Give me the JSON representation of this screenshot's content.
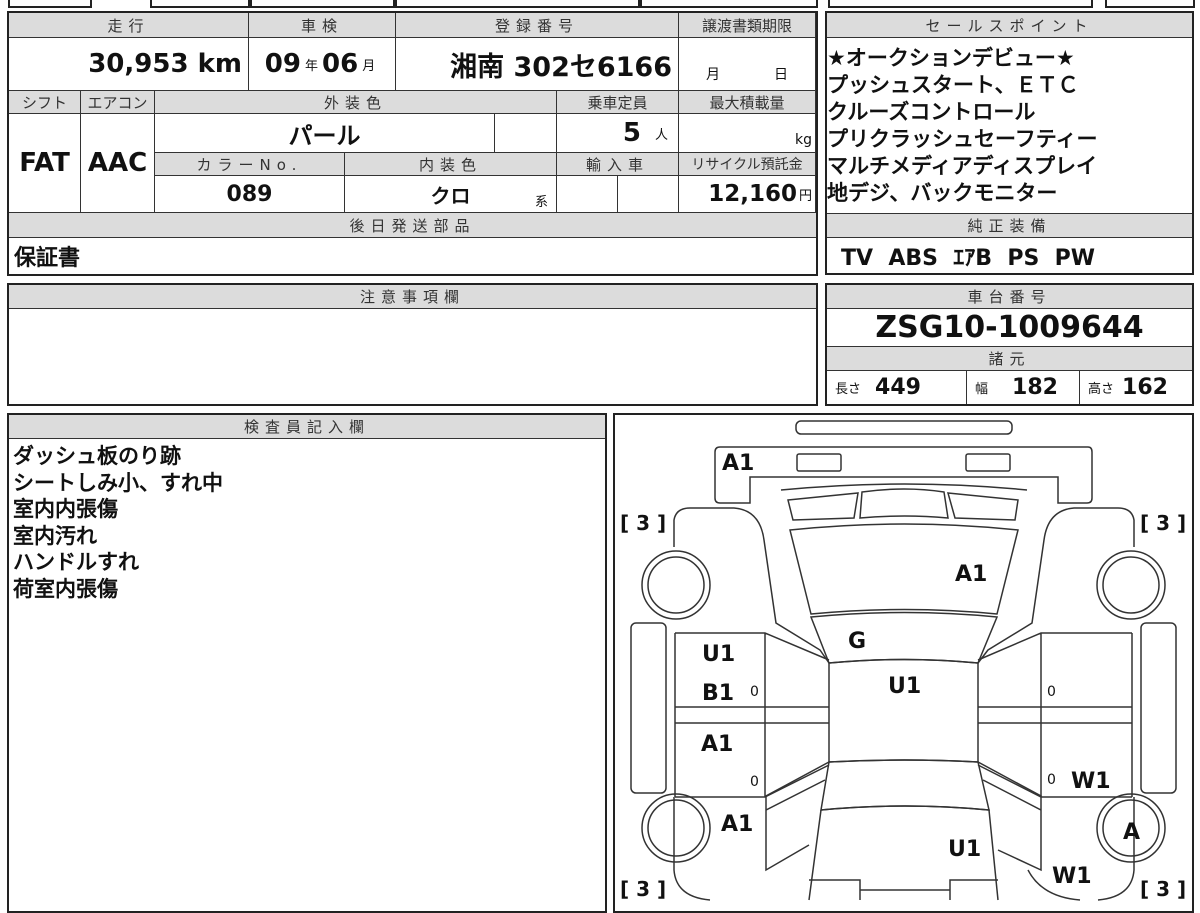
{
  "sheet": {
    "mileage": {
      "label": "走行",
      "value": "30,953",
      "unit": "km"
    },
    "inspection": {
      "label": "車検",
      "year": "09",
      "year_unit": "年",
      "month": "06",
      "month_unit": "月"
    },
    "registration": {
      "label": "登録番号",
      "value": "湘南 302セ6166"
    },
    "transfer": {
      "label": "譲渡書類期限",
      "month_unit": "月",
      "day_unit": "日"
    },
    "shift": {
      "label": "シフト",
      "value": "FAT"
    },
    "aircon": {
      "label": "エアコン",
      "value": "AAC"
    },
    "exterior": {
      "label": "外装色",
      "value": "パール"
    },
    "capacity": {
      "label": "乗車定員",
      "value": "5",
      "unit": "人"
    },
    "max_load": {
      "label": "最大積載量",
      "unit": "kg"
    },
    "color_no": {
      "label": "カラーNo.",
      "value": "089"
    },
    "interior": {
      "label": "内装色",
      "value": "クロ",
      "unit": "系"
    },
    "import": {
      "label": "輸入車"
    },
    "recycle": {
      "label": "リサイクル預託金",
      "value": "12,160",
      "unit": "円"
    },
    "later_parts": {
      "label": "後日発送部品",
      "value": "保証書"
    },
    "notes": {
      "label": "注意事項欄"
    },
    "inspector": {
      "label": "検査員記入欄",
      "lines": [
        "ダッシュ板のり跡",
        "シートしみ小、すれ中",
        "室内内張傷",
        "室内汚れ",
        "ハンドルすれ",
        "荷室内張傷"
      ]
    },
    "sales": {
      "label": "セールスポイント",
      "lines": [
        "★オークションデビュー★",
        "プッシュスタート、ＥＴＣ",
        "クルーズコントロール",
        "プリクラッシュセーフティー",
        "マルチメディアディスプレイ",
        "地デジ、バックモニター"
      ]
    },
    "equipment": {
      "label": "純正装備",
      "value": "TV  ABS  ｴｱB  PS  PW"
    },
    "chassis": {
      "label": "車台番号",
      "value": "ZSG10-1009644"
    },
    "specs": {
      "label": "諸元",
      "length_label": "長さ",
      "length": "449",
      "width_label": "幅",
      "width": "182",
      "height_label": "高さ",
      "height": "162"
    },
    "diagram": {
      "marks": [
        "A1",
        "[ 3 ]",
        "[ 3 ]",
        "A1",
        "G",
        "U1",
        "B1",
        "0",
        "U1",
        "0",
        "A1",
        "0",
        "0",
        "W1",
        "A1",
        "A",
        "U1",
        "W1",
        "[ 3 ]",
        "[ 3 ]"
      ]
    }
  }
}
